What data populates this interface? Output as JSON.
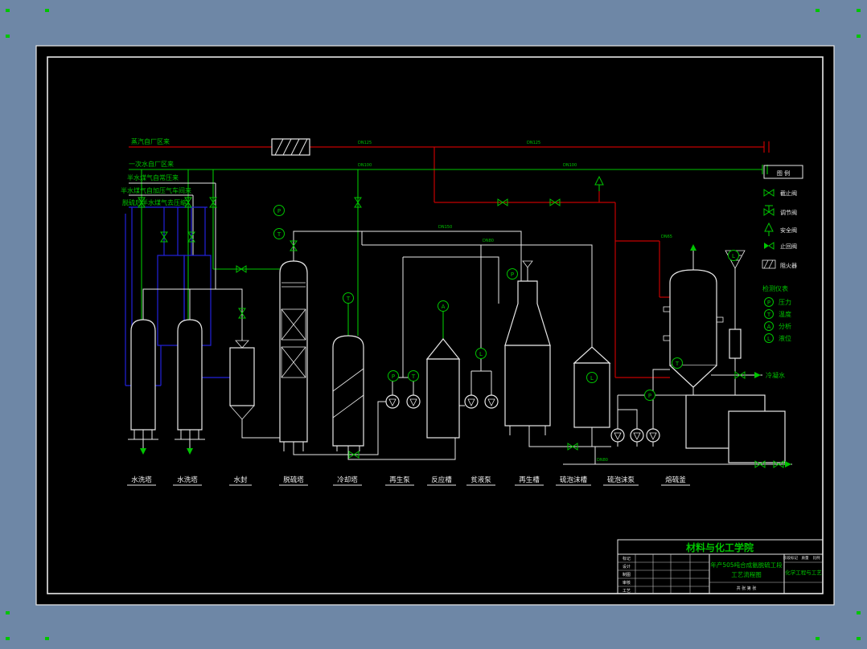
{
  "colors": {
    "background": "#6E87A6",
    "canvas": "#000000",
    "line_green": "#00C400",
    "line_red": "#C40000",
    "line_blue": "#2222DD",
    "line_white": "#E8E8E8"
  },
  "feed_labels": [
    "蒸汽自厂区来",
    "一次水自厂区来",
    "半水煤气自常压来",
    "半水煤气自加压气车间来",
    "脱硫后半水煤气去压缩"
  ],
  "equipment_labels": [
    "水洗塔",
    "水洗塔",
    "水封",
    "脱硫塔",
    "冷却塔",
    "再生泵",
    "反应槽",
    "贫液泵",
    "再生槽",
    "硫泡沫槽",
    "硫泡沫泵",
    "熔硫釜"
  ],
  "side_labels": {
    "condensate": "冷凝水"
  },
  "legend": {
    "title": "图 例",
    "items": [
      "截止阀",
      "调节阀",
      "安全阀",
      "止回阀",
      "阻火器"
    ],
    "instrument_title": "检测仪表",
    "instrument_rows": [
      {
        "sym": "P",
        "label": "压力"
      },
      {
        "sym": "T",
        "label": "温度"
      },
      {
        "sym": "A",
        "label": "分析"
      },
      {
        "sym": "L",
        "label": "液位"
      }
    ]
  },
  "bubbles": [
    "P",
    "T",
    "T",
    "A",
    "P",
    "T",
    "L",
    "P",
    "L",
    "P",
    "T",
    "L"
  ],
  "pipe_tags": [
    "DN125",
    "DN125",
    "DN100",
    "DN100",
    "DN150",
    "DN80",
    "DN80",
    "DN65"
  ],
  "title_block": {
    "school": "材料与化工学院",
    "drawing_title_line1": "年产505吨合成氨脱硫工段",
    "drawing_title_line2": "工艺流程图",
    "program": "化学工程与工艺",
    "fields": [
      "标记",
      "设计",
      "制图",
      "审核",
      "工艺"
    ],
    "right_fields": [
      "阶段标记",
      "质量",
      "比例"
    ],
    "sheet": "共 张 第 张"
  }
}
